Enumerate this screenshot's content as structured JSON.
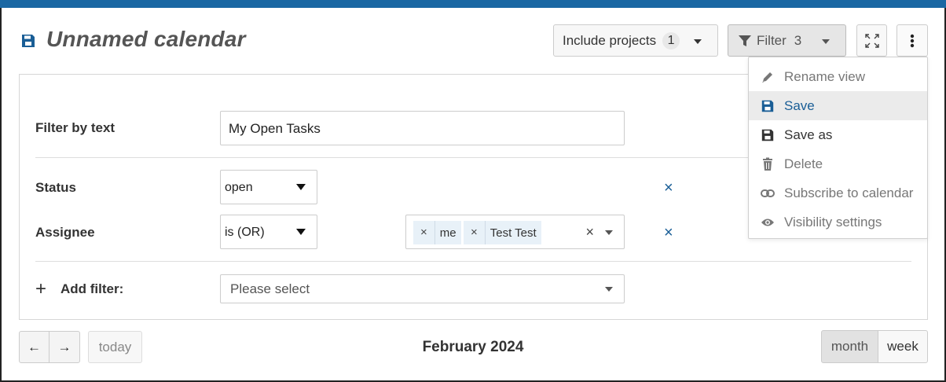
{
  "header": {
    "title": "Unnamed calendar",
    "include_projects_label": "Include projects",
    "include_projects_count": "1",
    "filter_label": "Filter",
    "filter_count": "3"
  },
  "filters": {
    "text_label": "Filter by text",
    "text_value": "My Open Tasks",
    "status_label": "Status",
    "status_value": "open",
    "assignee_label": "Assignee",
    "assignee_operator": "is (OR)",
    "assignee_tags": [
      "me",
      "Test Test"
    ],
    "remove_glyph": "×",
    "add_filter_label": "Add filter:",
    "add_filter_placeholder": "Please select"
  },
  "menu": {
    "items": [
      {
        "label": "Rename view",
        "icon": "pencil-icon"
      },
      {
        "label": "Save",
        "icon": "floppy-icon"
      },
      {
        "label": "Save as",
        "icon": "floppy-icon"
      },
      {
        "label": "Delete",
        "icon": "trash-icon"
      },
      {
        "label": "Subscribe to calendar",
        "icon": "link-icon"
      },
      {
        "label": "Visibility settings",
        "icon": "eye-icon"
      }
    ]
  },
  "footer": {
    "prev_glyph": "←",
    "next_glyph": "→",
    "today_label": "today",
    "current_period": "February 2024",
    "month_label": "month",
    "week_label": "week"
  },
  "colors": {
    "accent": "#1a67a3",
    "link_blue": "#1a5e96"
  }
}
